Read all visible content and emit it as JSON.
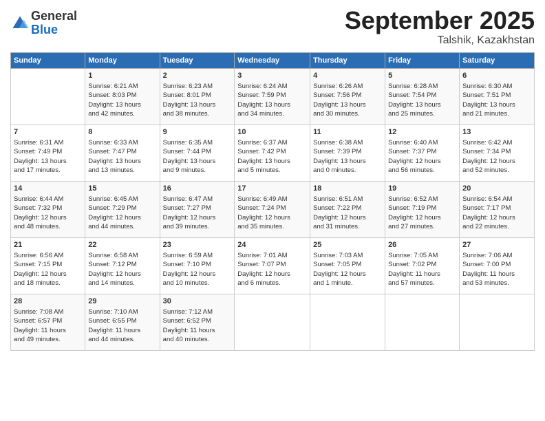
{
  "header": {
    "logo_general": "General",
    "logo_blue": "Blue",
    "month_title": "September 2025",
    "location": "Talshik, Kazakhstan"
  },
  "calendar": {
    "days_of_week": [
      "Sunday",
      "Monday",
      "Tuesday",
      "Wednesday",
      "Thursday",
      "Friday",
      "Saturday"
    ],
    "weeks": [
      [
        {
          "day": "",
          "info": ""
        },
        {
          "day": "1",
          "info": "Sunrise: 6:21 AM\nSunset: 8:03 PM\nDaylight: 13 hours\nand 42 minutes."
        },
        {
          "day": "2",
          "info": "Sunrise: 6:23 AM\nSunset: 8:01 PM\nDaylight: 13 hours\nand 38 minutes."
        },
        {
          "day": "3",
          "info": "Sunrise: 6:24 AM\nSunset: 7:59 PM\nDaylight: 13 hours\nand 34 minutes."
        },
        {
          "day": "4",
          "info": "Sunrise: 6:26 AM\nSunset: 7:56 PM\nDaylight: 13 hours\nand 30 minutes."
        },
        {
          "day": "5",
          "info": "Sunrise: 6:28 AM\nSunset: 7:54 PM\nDaylight: 13 hours\nand 25 minutes."
        },
        {
          "day": "6",
          "info": "Sunrise: 6:30 AM\nSunset: 7:51 PM\nDaylight: 13 hours\nand 21 minutes."
        }
      ],
      [
        {
          "day": "7",
          "info": "Sunrise: 6:31 AM\nSunset: 7:49 PM\nDaylight: 13 hours\nand 17 minutes."
        },
        {
          "day": "8",
          "info": "Sunrise: 6:33 AM\nSunset: 7:47 PM\nDaylight: 13 hours\nand 13 minutes."
        },
        {
          "day": "9",
          "info": "Sunrise: 6:35 AM\nSunset: 7:44 PM\nDaylight: 13 hours\nand 9 minutes."
        },
        {
          "day": "10",
          "info": "Sunrise: 6:37 AM\nSunset: 7:42 PM\nDaylight: 13 hours\nand 5 minutes."
        },
        {
          "day": "11",
          "info": "Sunrise: 6:38 AM\nSunset: 7:39 PM\nDaylight: 13 hours\nand 0 minutes."
        },
        {
          "day": "12",
          "info": "Sunrise: 6:40 AM\nSunset: 7:37 PM\nDaylight: 12 hours\nand 56 minutes."
        },
        {
          "day": "13",
          "info": "Sunrise: 6:42 AM\nSunset: 7:34 PM\nDaylight: 12 hours\nand 52 minutes."
        }
      ],
      [
        {
          "day": "14",
          "info": "Sunrise: 6:44 AM\nSunset: 7:32 PM\nDaylight: 12 hours\nand 48 minutes."
        },
        {
          "day": "15",
          "info": "Sunrise: 6:45 AM\nSunset: 7:29 PM\nDaylight: 12 hours\nand 44 minutes."
        },
        {
          "day": "16",
          "info": "Sunrise: 6:47 AM\nSunset: 7:27 PM\nDaylight: 12 hours\nand 39 minutes."
        },
        {
          "day": "17",
          "info": "Sunrise: 6:49 AM\nSunset: 7:24 PM\nDaylight: 12 hours\nand 35 minutes."
        },
        {
          "day": "18",
          "info": "Sunrise: 6:51 AM\nSunset: 7:22 PM\nDaylight: 12 hours\nand 31 minutes."
        },
        {
          "day": "19",
          "info": "Sunrise: 6:52 AM\nSunset: 7:19 PM\nDaylight: 12 hours\nand 27 minutes."
        },
        {
          "day": "20",
          "info": "Sunrise: 6:54 AM\nSunset: 7:17 PM\nDaylight: 12 hours\nand 22 minutes."
        }
      ],
      [
        {
          "day": "21",
          "info": "Sunrise: 6:56 AM\nSunset: 7:15 PM\nDaylight: 12 hours\nand 18 minutes."
        },
        {
          "day": "22",
          "info": "Sunrise: 6:58 AM\nSunset: 7:12 PM\nDaylight: 12 hours\nand 14 minutes."
        },
        {
          "day": "23",
          "info": "Sunrise: 6:59 AM\nSunset: 7:10 PM\nDaylight: 12 hours\nand 10 minutes."
        },
        {
          "day": "24",
          "info": "Sunrise: 7:01 AM\nSunset: 7:07 PM\nDaylight: 12 hours\nand 6 minutes."
        },
        {
          "day": "25",
          "info": "Sunrise: 7:03 AM\nSunset: 7:05 PM\nDaylight: 12 hours\nand 1 minute."
        },
        {
          "day": "26",
          "info": "Sunrise: 7:05 AM\nSunset: 7:02 PM\nDaylight: 11 hours\nand 57 minutes."
        },
        {
          "day": "27",
          "info": "Sunrise: 7:06 AM\nSunset: 7:00 PM\nDaylight: 11 hours\nand 53 minutes."
        }
      ],
      [
        {
          "day": "28",
          "info": "Sunrise: 7:08 AM\nSunset: 6:57 PM\nDaylight: 11 hours\nand 49 minutes."
        },
        {
          "day": "29",
          "info": "Sunrise: 7:10 AM\nSunset: 6:55 PM\nDaylight: 11 hours\nand 44 minutes."
        },
        {
          "day": "30",
          "info": "Sunrise: 7:12 AM\nSunset: 6:52 PM\nDaylight: 11 hours\nand 40 minutes."
        },
        {
          "day": "",
          "info": ""
        },
        {
          "day": "",
          "info": ""
        },
        {
          "day": "",
          "info": ""
        },
        {
          "day": "",
          "info": ""
        }
      ]
    ]
  }
}
